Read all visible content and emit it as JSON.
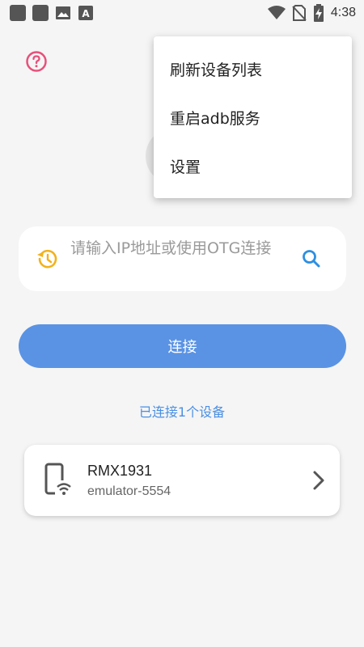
{
  "status_bar": {
    "time": "4:38",
    "left_icons": [
      "notification-square-icon",
      "notification-square-icon",
      "image-icon",
      "app-notification-icon"
    ],
    "right_icons": [
      "wifi-icon",
      "no-sim-icon",
      "battery-charging-icon"
    ]
  },
  "header": {
    "help_icon": "help-circle-icon",
    "help_color": "#e8507a"
  },
  "menu": {
    "items": [
      {
        "label": "刷新设备列表"
      },
      {
        "label": "重启adb服务"
      },
      {
        "label": "设置"
      }
    ]
  },
  "search": {
    "placeholder": "请输入IP地址或使用OTG连接",
    "history_icon": "history-icon",
    "history_color": "#f2b21b",
    "search_icon": "search-icon",
    "search_color": "#2d8fe0"
  },
  "connect_button": {
    "label": "连接",
    "color": "#5a93e4"
  },
  "connected_count": "已连接1个设备",
  "devices": [
    {
      "name": "RMX1931",
      "serial": "emulator-5554",
      "icon": "phone-wifi-icon"
    }
  ]
}
